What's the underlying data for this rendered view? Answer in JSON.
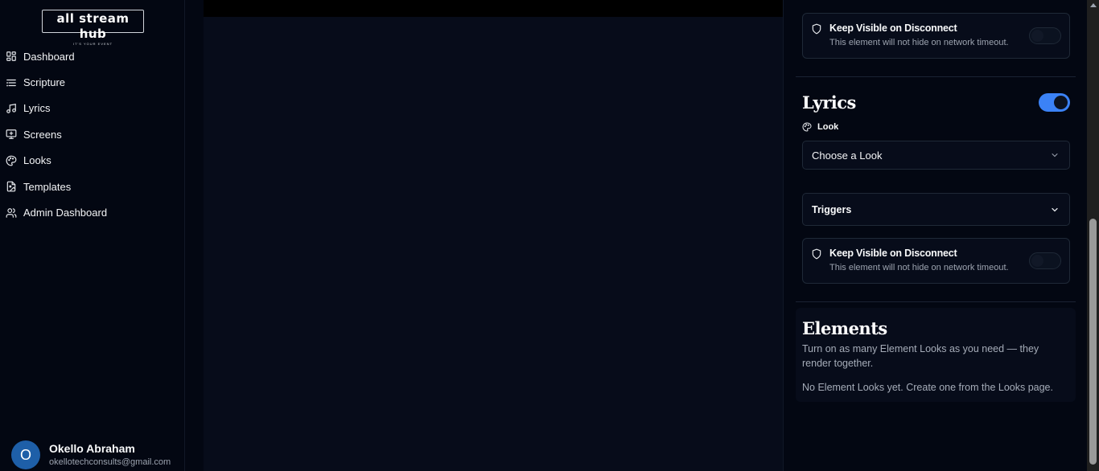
{
  "app": {
    "logo_text": "all stream hub",
    "logo_tagline": "IT'S YOUR EVENT"
  },
  "sidebar": {
    "items": [
      {
        "label": "Dashboard",
        "icon": "grid-icon"
      },
      {
        "label": "Scripture",
        "icon": "list-icon"
      },
      {
        "label": "Lyrics",
        "icon": "music-icon"
      },
      {
        "label": "Screens",
        "icon": "monitor-icon"
      },
      {
        "label": "Looks",
        "icon": "palette-icon"
      },
      {
        "label": "Templates",
        "icon": "image-file-icon"
      },
      {
        "label": "Admin Dashboard",
        "icon": "users-icon"
      }
    ]
  },
  "user": {
    "initial": "O",
    "name": "Okello Abraham",
    "email": "okellotechconsults@gmail.com"
  },
  "panel": {
    "keep_visible_top": {
      "title": "Keep Visible on Disconnect",
      "description": "This element will not hide on network timeout.",
      "enabled": false
    },
    "lyrics": {
      "title": "Lyrics",
      "enabled": true,
      "look_label": "Look",
      "look_select": "Choose a Look",
      "triggers_label": "Triggers",
      "keep_visible": {
        "title": "Keep Visible on Disconnect",
        "description": "This element will not hide on network timeout.",
        "enabled": false
      }
    },
    "elements": {
      "title": "Elements",
      "description": "Turn on as many Element Looks as you need — they render together.",
      "empty_text": "No Element Looks yet. Create one from the Looks page."
    }
  },
  "colors": {
    "accent": "#3b82f6",
    "avatar": "#1e5fa8",
    "background": "#030712"
  }
}
